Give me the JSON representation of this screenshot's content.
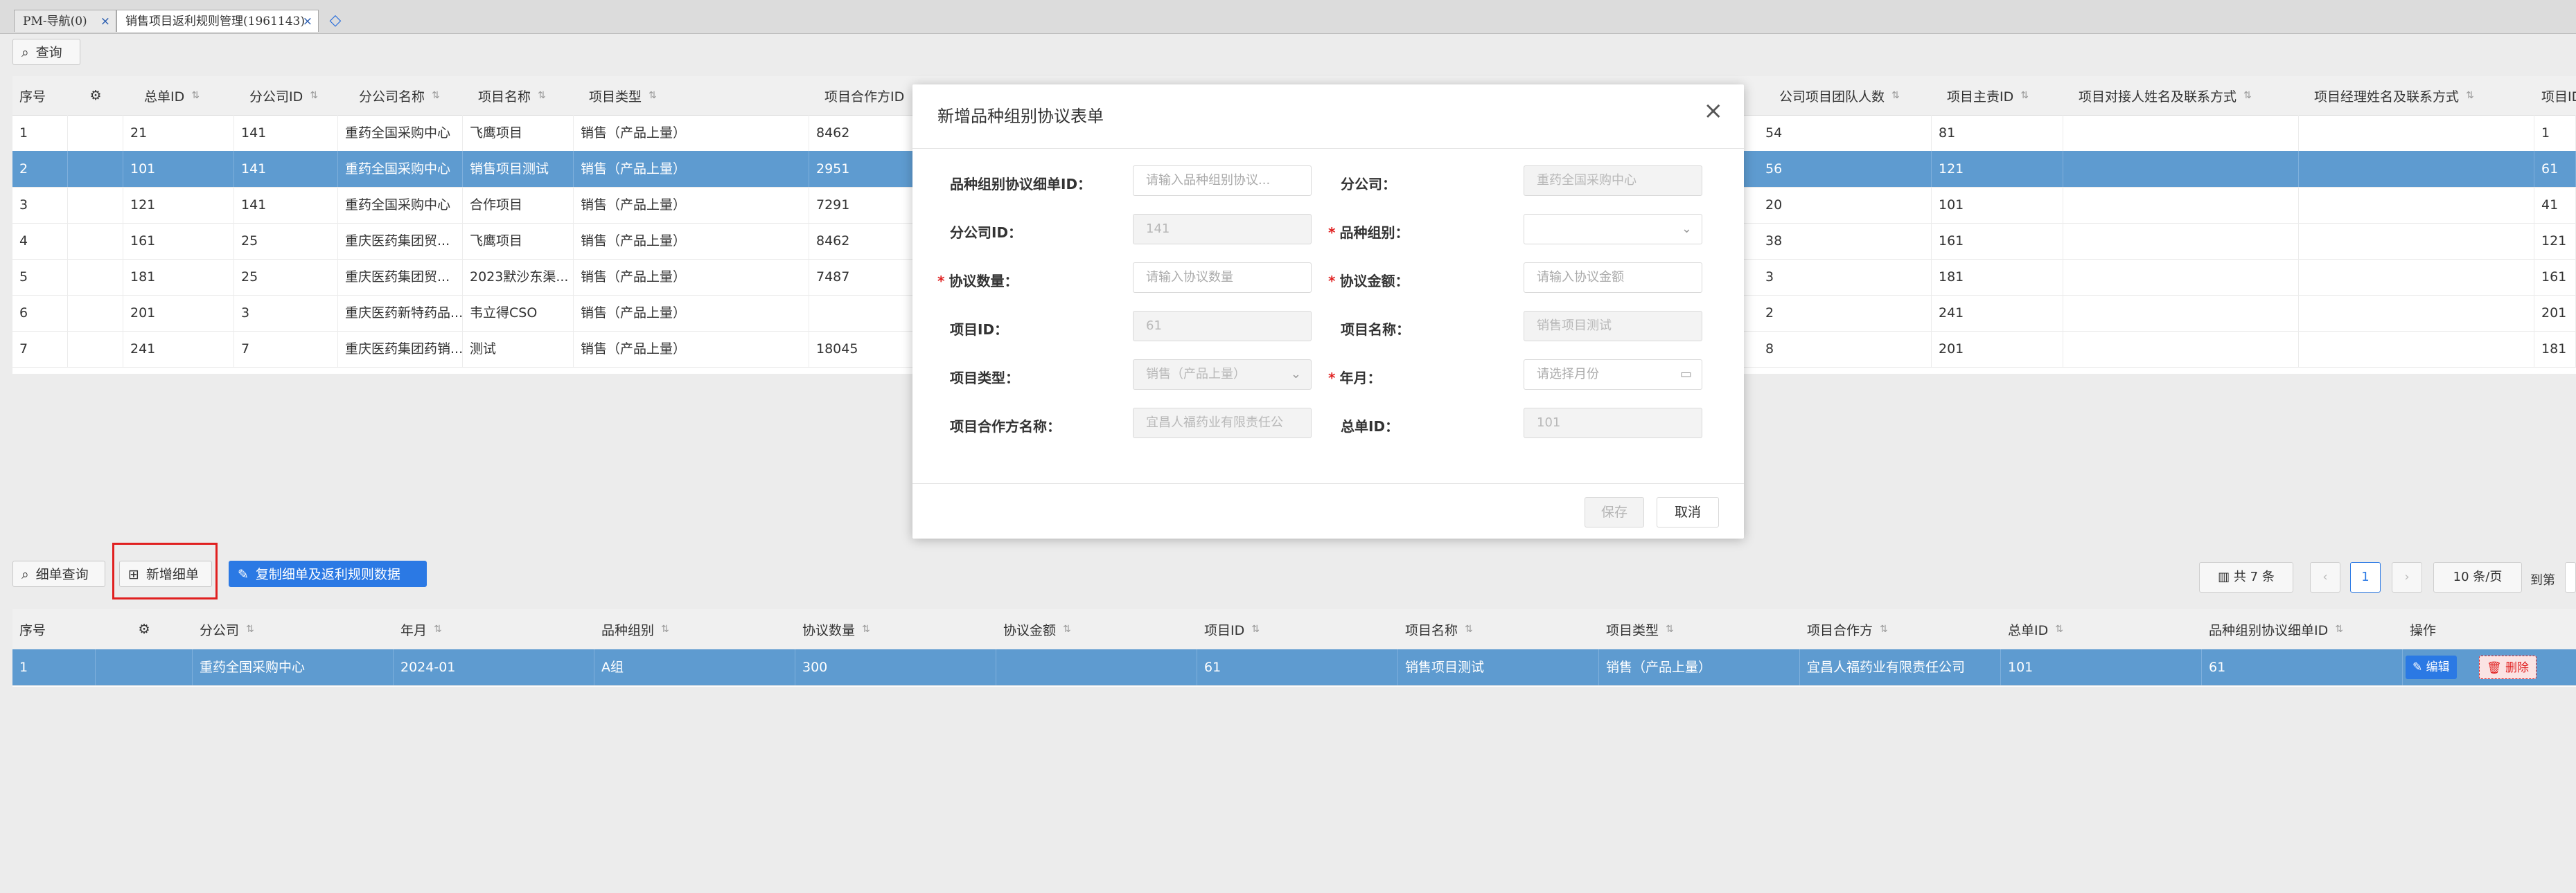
{
  "tabs": [
    {
      "label": "PM-导航(0)",
      "close": "×"
    },
    {
      "label": "销售项目返利规则管理(1961143)",
      "close": "×"
    }
  ],
  "tab_plus": "◇",
  "top_toolbar": {
    "query_label": "查询"
  },
  "top_table": {
    "columns": [
      "序号",
      "总单ID",
      "分公司ID",
      "分公司名称",
      "项目名称",
      "项目类型",
      "项目合作方ID"
    ],
    "right_columns": [
      "公司项目团队人数",
      "项目主责ID",
      "项目对接人姓名及联系方式",
      "项目经理姓名及联系方式",
      "项目ID"
    ],
    "rows": [
      {
        "cells": [
          "1",
          "21",
          "141",
          "重药全国采购中心",
          "飞鹰项目",
          "销售（产品上量）",
          "8462"
        ],
        "right": [
          "54",
          "81",
          "",
          "",
          "1"
        ]
      },
      {
        "cells": [
          "2",
          "101",
          "141",
          "重药全国采购中心",
          "销售项目测试",
          "销售（产品上量）",
          "2951"
        ],
        "right": [
          "56",
          "121",
          "",
          "",
          "61"
        ]
      },
      {
        "cells": [
          "3",
          "121",
          "141",
          "重药全国采购中心",
          "合作项目",
          "销售（产品上量）",
          "7291"
        ],
        "right": [
          "20",
          "101",
          "",
          "",
          "41"
        ]
      },
      {
        "cells": [
          "4",
          "161",
          "25",
          "重庆医药集团贸...",
          "飞鹰项目",
          "销售（产品上量）",
          "8462"
        ],
        "right": [
          "38",
          "161",
          "",
          "",
          "121"
        ]
      },
      {
        "cells": [
          "5",
          "181",
          "25",
          "重庆医药集团贸...",
          "2023默沙东渠...",
          "销售（产品上量）",
          "7487"
        ],
        "right": [
          "3",
          "181",
          "",
          "",
          "161"
        ]
      },
      {
        "cells": [
          "6",
          "201",
          "3",
          "重庆医药新特药品...",
          "韦立得CSO",
          "销售（产品上量）",
          ""
        ],
        "right": [
          "2",
          "241",
          "",
          "",
          "201"
        ]
      },
      {
        "cells": [
          "7",
          "241",
          "7",
          "重庆医药集团药销...",
          "测试",
          "销售（产品上量）",
          "18045"
        ],
        "right": [
          "8",
          "201",
          "",
          "",
          "181"
        ]
      }
    ]
  },
  "modal": {
    "title": "新增品种组别协议表单",
    "close": "×",
    "fields": {
      "detail_id": {
        "label": "品种组别协议细单ID：",
        "placeholder": "请输入品种组别协议..."
      },
      "branch": {
        "label": "分公司：",
        "value": "重药全国采购中心"
      },
      "branch_id": {
        "label": "分公司ID：",
        "value": "141"
      },
      "variety_group": {
        "label": "品种组别：",
        "value": "",
        "suffix": "⌄"
      },
      "qty": {
        "label": "协议数量：",
        "placeholder": "请输入协议数量"
      },
      "amount": {
        "label": "协议金额：",
        "placeholder": "请输入协议金额"
      },
      "project_id": {
        "label": "项目ID：",
        "value": "61"
      },
      "project_name": {
        "label": "项目名称：",
        "value": "销售项目测试"
      },
      "project_type": {
        "label": "项目类型：",
        "value": "销售（产品上量）",
        "suffix": "⌄"
      },
      "year_month": {
        "label": "年月：",
        "placeholder": "请选择月份",
        "suffix": "▭"
      },
      "partner_name": {
        "label": "项目合作方名称：",
        "value": "宜昌人福药业有限责任公"
      },
      "order_id": {
        "label": "总单ID：",
        "value": "101"
      }
    },
    "save": "保存",
    "cancel": "取消"
  },
  "bottom_toolbar": {
    "detail_query": "细单查询",
    "add_detail": "新增细单",
    "copy_detail": "复制细单及返利规则数据"
  },
  "pager": {
    "total": "共 7 条",
    "prev": "‹",
    "page": "1",
    "next": "›",
    "size": "10 条/页",
    "goto": "到第"
  },
  "bottom_table": {
    "columns": [
      "序号",
      "分公司",
      "年月",
      "品种组别",
      "协议数量",
      "协议金额",
      "项目ID",
      "项目名称",
      "项目类型",
      "项目合作方",
      "总单ID",
      "品种组别协议细单ID",
      "操作"
    ],
    "rows": [
      {
        "cells": [
          "1",
          "重药全国采购中心",
          "2024-01",
          "A组",
          "300",
          "",
          "61",
          "销售项目测试",
          "销售（产品上量）",
          "宜昌人福药业有限责任公司",
          "101",
          "61"
        ],
        "edit": "编辑",
        "delete": "删除"
      }
    ]
  },
  "colors": {
    "accent": "#2b79e4",
    "selected_row": "#5e9bd0",
    "required": "#e02020"
  }
}
